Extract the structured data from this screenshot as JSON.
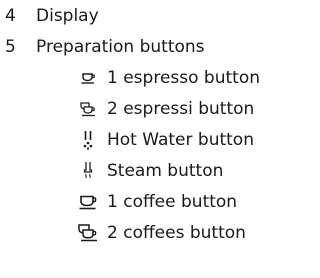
{
  "items": [
    {
      "number": "4",
      "label": "Display"
    },
    {
      "number": "5",
      "label": "Preparation buttons"
    }
  ],
  "sub_items": [
    {
      "icon": "espresso-cup-icon",
      "label": "1 espresso button"
    },
    {
      "icon": "two-espresso-cups-icon",
      "label": "2 espressi button"
    },
    {
      "icon": "hot-water-icon",
      "label": "Hot Water button"
    },
    {
      "icon": "steam-icon",
      "label": "Steam button"
    },
    {
      "icon": "coffee-cup-icon",
      "label": "1 coffee button"
    },
    {
      "icon": "two-coffee-cups-icon",
      "label": "2 coffees button"
    }
  ]
}
